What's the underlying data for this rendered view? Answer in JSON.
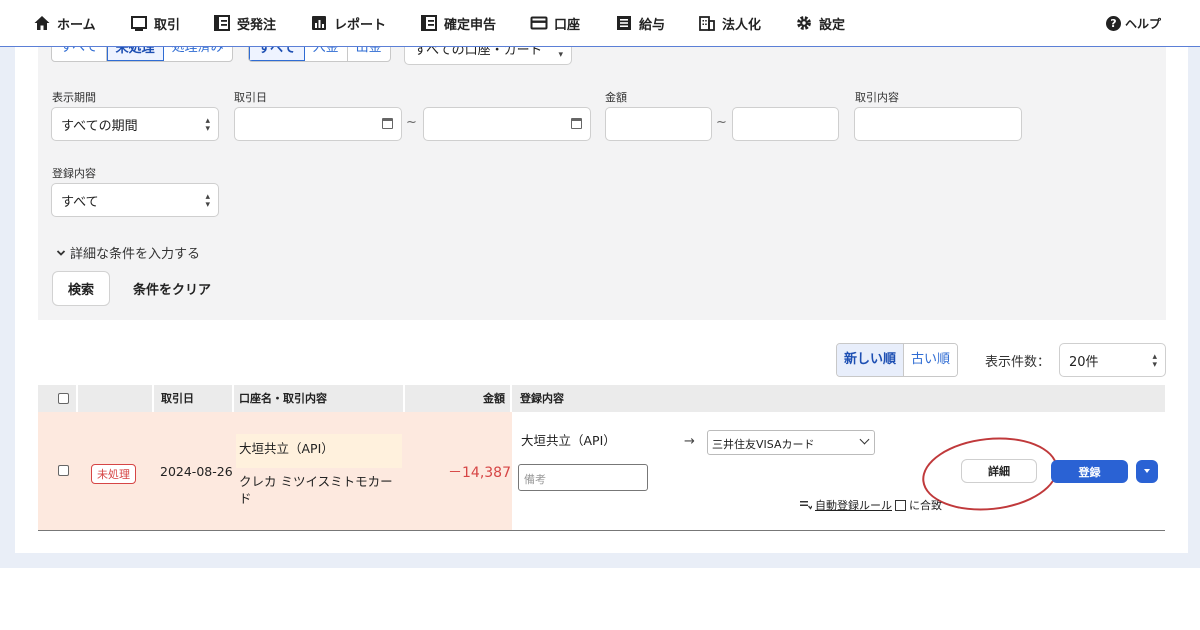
{
  "nav": {
    "items": [
      {
        "label": "ホーム",
        "icon": "home-icon"
      },
      {
        "label": "取引",
        "icon": "transactions-icon"
      },
      {
        "label": "受発注",
        "icon": "orders-icon"
      },
      {
        "label": "レポート",
        "icon": "report-chart-icon"
      },
      {
        "label": "確定申告",
        "icon": "tax-return-icon"
      },
      {
        "label": "口座",
        "icon": "wallet-card-icon"
      },
      {
        "label": "給与",
        "icon": "payroll-icon"
      },
      {
        "label": "法人化",
        "icon": "building-icon"
      },
      {
        "label": "設定",
        "icon": "gear-icon"
      }
    ],
    "help": "ヘルプ"
  },
  "filters": {
    "status_tabs": [
      "すべて",
      "未処理",
      "処理済み"
    ],
    "status_selected": "未処理",
    "type_tabs": [
      "すべて",
      "入金",
      "出金"
    ],
    "type_selected": "すべて",
    "account_filter": "すべての口座・カード",
    "period": {
      "label": "表示期間",
      "value": "すべての期間"
    },
    "date": {
      "label": "取引日",
      "from": "",
      "to": ""
    },
    "amount": {
      "label": "金額",
      "from": "",
      "to": ""
    },
    "description": {
      "label": "取引内容",
      "value": ""
    },
    "registration": {
      "label": "登録内容",
      "value": "すべて"
    },
    "range_separator": "~",
    "detail_toggle": "詳細な条件を入力する",
    "search_button": "検索",
    "clear_button": "条件をクリア"
  },
  "list_controls": {
    "sort_newest": "新しい順",
    "sort_oldest": "古い順",
    "sort_selected": "新しい順",
    "per_page_label": "表示件数：",
    "per_page_value": "20件"
  },
  "table": {
    "headers": {
      "date": "取引日",
      "account": "口座名・取引内容",
      "amount": "金額",
      "registration": "登録内容"
    },
    "rows": [
      {
        "status": "未処理",
        "date": "2024-08-26",
        "account_name": "大垣共立（API）",
        "description": "クレカ ミツイスミトモカード",
        "amount": "－14,387",
        "registered_account": "大垣共立（API）",
        "memo_placeholder": "備考",
        "target_account": "三井住友VISAカード",
        "detail_button": "詳細",
        "register_button": "登録",
        "rule_link": "自動登録ルール",
        "rule_suffix": "に合致"
      }
    ]
  },
  "colors": {
    "accent": "#2a62d4",
    "negative": "#d64545",
    "unprocessed_row": "#fde9df",
    "highlight_ring": "#c0393b"
  }
}
